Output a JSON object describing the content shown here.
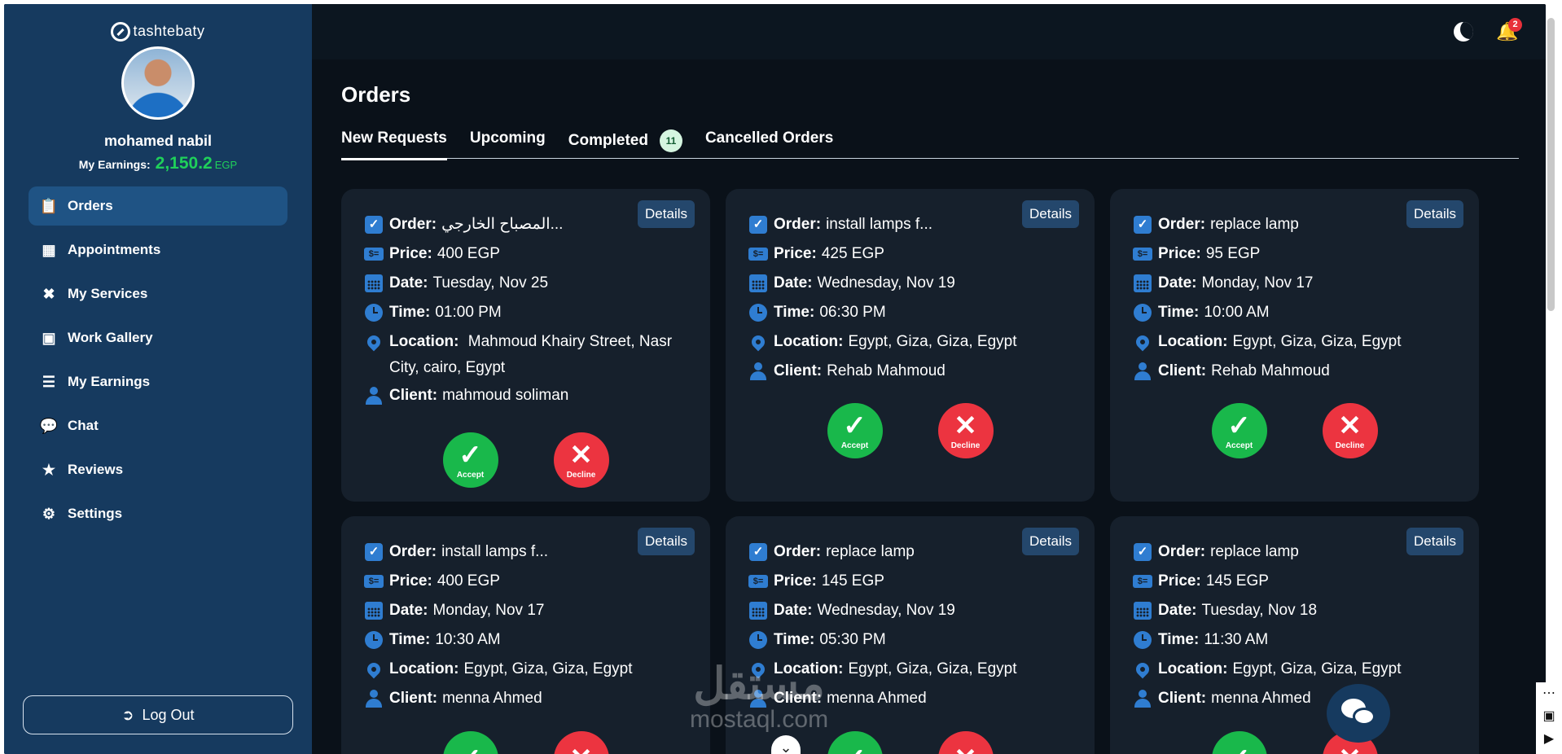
{
  "sidebar": {
    "brand": "tashtebaty",
    "user_name": "mohamed nabil",
    "earnings_label": "My Earnings:",
    "earnings_amount": "2,150.2",
    "earnings_currency": "EGP",
    "items": [
      {
        "label": "Orders",
        "icon": "clipboard-icon",
        "active": true
      },
      {
        "label": "Appointments",
        "icon": "calendar-icon"
      },
      {
        "label": "My Services",
        "icon": "tools-icon"
      },
      {
        "label": "Work Gallery",
        "icon": "image-icon"
      },
      {
        "label": "My Earnings",
        "icon": "coins-icon"
      },
      {
        "label": "Chat",
        "icon": "chat-icon"
      },
      {
        "label": "Reviews",
        "icon": "star-icon"
      },
      {
        "label": "Settings",
        "icon": "gear-icon"
      }
    ],
    "logout_label": "Log Out"
  },
  "topbar": {
    "notification_count": "2"
  },
  "page": {
    "title": "Orders",
    "tabs": [
      {
        "label": "New Requests",
        "active": true
      },
      {
        "label": "Upcoming"
      },
      {
        "label": "Completed",
        "count": "11"
      },
      {
        "label": "Cancelled Orders"
      }
    ]
  },
  "labels": {
    "order": "Order:",
    "price": "Price:",
    "date": "Date:",
    "time": "Time:",
    "location": "Location:",
    "client": "Client:",
    "details": "Details",
    "accept": "Accept",
    "decline": "Decline"
  },
  "orders": [
    {
      "order": "المصباح الخارجي...",
      "price": "400 EGP",
      "date": "Tuesday, Nov 25",
      "time": "01:00 PM",
      "location": "Mahmoud Khairy Street, Nasr City, cairo, Egypt",
      "client": "mahmoud soliman"
    },
    {
      "order": "install lamps f...",
      "price": "425 EGP",
      "date": "Wednesday, Nov 19",
      "time": "06:30 PM",
      "location": "Egypt, Giza, Giza, Egypt",
      "client": "Rehab Mahmoud"
    },
    {
      "order": "replace lamp",
      "price": "95 EGP",
      "date": "Monday, Nov 17",
      "time": "10:00 AM",
      "location": "Egypt, Giza, Giza, Egypt",
      "client": "Rehab Mahmoud"
    },
    {
      "order": "install lamps f...",
      "price": "400 EGP",
      "date": "Monday, Nov 17",
      "time": "10:30 AM",
      "location": "Egypt, Giza, Giza, Egypt",
      "client": "menna Ahmed"
    },
    {
      "order": "replace lamp",
      "price": "145 EGP",
      "date": "Wednesday, Nov 19",
      "time": "05:30 PM",
      "location": "Egypt, Giza, Giza, Egypt",
      "client": "menna Ahmed"
    },
    {
      "order": "replace lamp",
      "price": "145 EGP",
      "date": "Tuesday, Nov 18",
      "time": "11:30 AM",
      "location": "Egypt, Giza, Giza, Egypt",
      "client": "menna Ahmed"
    }
  ],
  "watermark": {
    "arabic": "مستقل",
    "latin": "mostaql.com"
  }
}
